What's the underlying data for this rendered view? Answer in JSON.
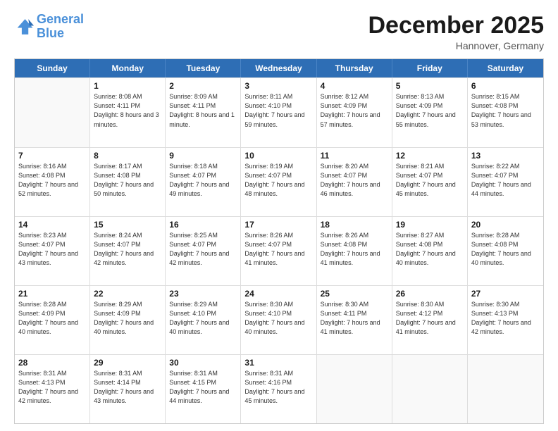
{
  "logo": {
    "line1": "General",
    "line2": "Blue"
  },
  "title": "December 2025",
  "subtitle": "Hannover, Germany",
  "days_header": [
    "Sunday",
    "Monday",
    "Tuesday",
    "Wednesday",
    "Thursday",
    "Friday",
    "Saturday"
  ],
  "weeks": [
    [
      {
        "day": "",
        "sunrise": "",
        "sunset": "",
        "daylight": ""
      },
      {
        "day": "1",
        "sunrise": "Sunrise: 8:08 AM",
        "sunset": "Sunset: 4:11 PM",
        "daylight": "Daylight: 8 hours and 3 minutes."
      },
      {
        "day": "2",
        "sunrise": "Sunrise: 8:09 AM",
        "sunset": "Sunset: 4:11 PM",
        "daylight": "Daylight: 8 hours and 1 minute."
      },
      {
        "day": "3",
        "sunrise": "Sunrise: 8:11 AM",
        "sunset": "Sunset: 4:10 PM",
        "daylight": "Daylight: 7 hours and 59 minutes."
      },
      {
        "day": "4",
        "sunrise": "Sunrise: 8:12 AM",
        "sunset": "Sunset: 4:09 PM",
        "daylight": "Daylight: 7 hours and 57 minutes."
      },
      {
        "day": "5",
        "sunrise": "Sunrise: 8:13 AM",
        "sunset": "Sunset: 4:09 PM",
        "daylight": "Daylight: 7 hours and 55 minutes."
      },
      {
        "day": "6",
        "sunrise": "Sunrise: 8:15 AM",
        "sunset": "Sunset: 4:08 PM",
        "daylight": "Daylight: 7 hours and 53 minutes."
      }
    ],
    [
      {
        "day": "7",
        "sunrise": "Sunrise: 8:16 AM",
        "sunset": "Sunset: 4:08 PM",
        "daylight": "Daylight: 7 hours and 52 minutes."
      },
      {
        "day": "8",
        "sunrise": "Sunrise: 8:17 AM",
        "sunset": "Sunset: 4:08 PM",
        "daylight": "Daylight: 7 hours and 50 minutes."
      },
      {
        "day": "9",
        "sunrise": "Sunrise: 8:18 AM",
        "sunset": "Sunset: 4:07 PM",
        "daylight": "Daylight: 7 hours and 49 minutes."
      },
      {
        "day": "10",
        "sunrise": "Sunrise: 8:19 AM",
        "sunset": "Sunset: 4:07 PM",
        "daylight": "Daylight: 7 hours and 48 minutes."
      },
      {
        "day": "11",
        "sunrise": "Sunrise: 8:20 AM",
        "sunset": "Sunset: 4:07 PM",
        "daylight": "Daylight: 7 hours and 46 minutes."
      },
      {
        "day": "12",
        "sunrise": "Sunrise: 8:21 AM",
        "sunset": "Sunset: 4:07 PM",
        "daylight": "Daylight: 7 hours and 45 minutes."
      },
      {
        "day": "13",
        "sunrise": "Sunrise: 8:22 AM",
        "sunset": "Sunset: 4:07 PM",
        "daylight": "Daylight: 7 hours and 44 minutes."
      }
    ],
    [
      {
        "day": "14",
        "sunrise": "Sunrise: 8:23 AM",
        "sunset": "Sunset: 4:07 PM",
        "daylight": "Daylight: 7 hours and 43 minutes."
      },
      {
        "day": "15",
        "sunrise": "Sunrise: 8:24 AM",
        "sunset": "Sunset: 4:07 PM",
        "daylight": "Daylight: 7 hours and 42 minutes."
      },
      {
        "day": "16",
        "sunrise": "Sunrise: 8:25 AM",
        "sunset": "Sunset: 4:07 PM",
        "daylight": "Daylight: 7 hours and 42 minutes."
      },
      {
        "day": "17",
        "sunrise": "Sunrise: 8:26 AM",
        "sunset": "Sunset: 4:07 PM",
        "daylight": "Daylight: 7 hours and 41 minutes."
      },
      {
        "day": "18",
        "sunrise": "Sunrise: 8:26 AM",
        "sunset": "Sunset: 4:08 PM",
        "daylight": "Daylight: 7 hours and 41 minutes."
      },
      {
        "day": "19",
        "sunrise": "Sunrise: 8:27 AM",
        "sunset": "Sunset: 4:08 PM",
        "daylight": "Daylight: 7 hours and 40 minutes."
      },
      {
        "day": "20",
        "sunrise": "Sunrise: 8:28 AM",
        "sunset": "Sunset: 4:08 PM",
        "daylight": "Daylight: 7 hours and 40 minutes."
      }
    ],
    [
      {
        "day": "21",
        "sunrise": "Sunrise: 8:28 AM",
        "sunset": "Sunset: 4:09 PM",
        "daylight": "Daylight: 7 hours and 40 minutes."
      },
      {
        "day": "22",
        "sunrise": "Sunrise: 8:29 AM",
        "sunset": "Sunset: 4:09 PM",
        "daylight": "Daylight: 7 hours and 40 minutes."
      },
      {
        "day": "23",
        "sunrise": "Sunrise: 8:29 AM",
        "sunset": "Sunset: 4:10 PM",
        "daylight": "Daylight: 7 hours and 40 minutes."
      },
      {
        "day": "24",
        "sunrise": "Sunrise: 8:30 AM",
        "sunset": "Sunset: 4:10 PM",
        "daylight": "Daylight: 7 hours and 40 minutes."
      },
      {
        "day": "25",
        "sunrise": "Sunrise: 8:30 AM",
        "sunset": "Sunset: 4:11 PM",
        "daylight": "Daylight: 7 hours and 41 minutes."
      },
      {
        "day": "26",
        "sunrise": "Sunrise: 8:30 AM",
        "sunset": "Sunset: 4:12 PM",
        "daylight": "Daylight: 7 hours and 41 minutes."
      },
      {
        "day": "27",
        "sunrise": "Sunrise: 8:30 AM",
        "sunset": "Sunset: 4:13 PM",
        "daylight": "Daylight: 7 hours and 42 minutes."
      }
    ],
    [
      {
        "day": "28",
        "sunrise": "Sunrise: 8:31 AM",
        "sunset": "Sunset: 4:13 PM",
        "daylight": "Daylight: 7 hours and 42 minutes."
      },
      {
        "day": "29",
        "sunrise": "Sunrise: 8:31 AM",
        "sunset": "Sunset: 4:14 PM",
        "daylight": "Daylight: 7 hours and 43 minutes."
      },
      {
        "day": "30",
        "sunrise": "Sunrise: 8:31 AM",
        "sunset": "Sunset: 4:15 PM",
        "daylight": "Daylight: 7 hours and 44 minutes."
      },
      {
        "day": "31",
        "sunrise": "Sunrise: 8:31 AM",
        "sunset": "Sunset: 4:16 PM",
        "daylight": "Daylight: 7 hours and 45 minutes."
      },
      {
        "day": "",
        "sunrise": "",
        "sunset": "",
        "daylight": ""
      },
      {
        "day": "",
        "sunrise": "",
        "sunset": "",
        "daylight": ""
      },
      {
        "day": "",
        "sunrise": "",
        "sunset": "",
        "daylight": ""
      }
    ]
  ]
}
